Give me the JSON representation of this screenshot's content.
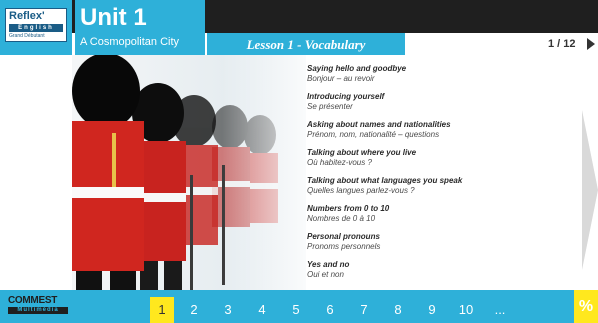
{
  "header": {
    "logo": {
      "title": "Reflex'",
      "bar": "English",
      "sub": "Grand Débutant"
    },
    "unit_title": "Unit 1",
    "unit_subtitle": "A Cosmopolitan City",
    "lesson_label": "Lesson 1 - Vocabulary",
    "page_counter": "1 / 12"
  },
  "photo": {
    "description_icon": "royal-guards-photo"
  },
  "topics": [
    {
      "en": "Saying hello and goodbye",
      "fr": "Bonjour – au revoir"
    },
    {
      "en": "Introducing yourself",
      "fr": "Se présenter"
    },
    {
      "en": "Asking about names and nationalities",
      "fr": "Prénom, nom, nationalité – questions"
    },
    {
      "en": "Talking about where you live",
      "fr": "Où habitez-vous ?"
    },
    {
      "en": "Talking about what languages you speak",
      "fr": "Quelles langues parlez-vous ?"
    },
    {
      "en": "Numbers from 0 to 10",
      "fr": "Nombres de 0 à 10"
    },
    {
      "en": "Personal pronouns",
      "fr": "Pronoms personnels"
    },
    {
      "en": "Yes and no",
      "fr": "Oui et non"
    }
  ],
  "footer": {
    "brand_name": "COMMEST",
    "brand_bar": "Multimédia",
    "brand_sub": "",
    "pages": [
      "1",
      "2",
      "3",
      "4",
      "5",
      "6",
      "7",
      "8",
      "9",
      "10",
      "..."
    ],
    "active_page": "1",
    "percent_label": "%"
  },
  "colors": {
    "accent": "#2eb0d9",
    "highlight": "#ffe81e",
    "dark": "#1f1f1f",
    "guard_red": "#c8231f"
  }
}
